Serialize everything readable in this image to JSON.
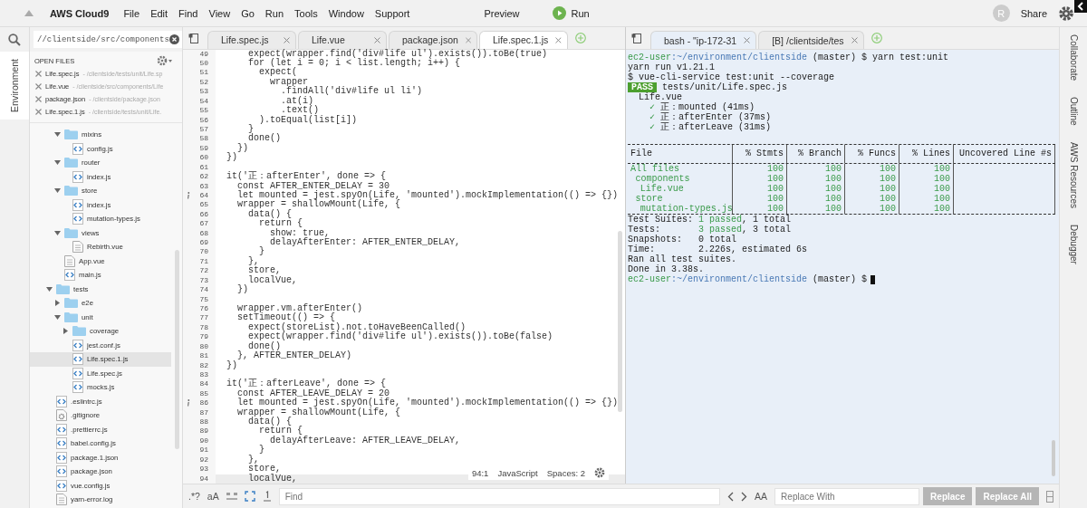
{
  "menu_bar": {
    "app_name": "AWS Cloud9",
    "menus": [
      "File",
      "Edit",
      "Find",
      "View",
      "Go",
      "Run",
      "Tools",
      "Window",
      "Support"
    ],
    "preview": "Preview",
    "run": "Run",
    "avatar": "R",
    "share": "Share"
  },
  "left_panel": {
    "tabs": [
      {
        "label": "Environment",
        "selected": true
      }
    ]
  },
  "sidebar": {
    "search": {
      "value": "//clientside/src/components"
    },
    "open_files_title": "OPEN FILES",
    "open_files": [
      {
        "name": "Life.spec.js",
        "path": "- /clientside/tests/unit/Life.sp"
      },
      {
        "name": "Life.vue",
        "path": "- /clientside/src/components/Life"
      },
      {
        "name": "package.json",
        "path": "- /clientside/package.json"
      },
      {
        "name": "Life.spec.1.js",
        "path": "- /clientside/tests/unit/Life."
      }
    ],
    "tree": [
      {
        "children": [
          {
            "name": "mixins",
            "kind": "folder",
            "expanded": true,
            "selected": false,
            "children": [
              {
                "name": "config.js",
                "kind": "code",
                "selected": false
              }
            ]
          },
          {
            "name": "router",
            "kind": "folder",
            "expanded": true,
            "selected": false,
            "children": [
              {
                "name": "index.js",
                "kind": "code",
                "selected": false
              }
            ]
          },
          {
            "name": "store",
            "kind": "folder",
            "expanded": true,
            "selected": false,
            "children": [
              {
                "name": "index.js",
                "kind": "code",
                "selected": false
              },
              {
                "name": "mutation-types.js",
                "kind": "code",
                "selected": false
              }
            ]
          },
          {
            "name": "views",
            "kind": "folder",
            "expanded": true,
            "selected": false,
            "children": [
              {
                "name": "Rebirth.vue",
                "kind": "doc",
                "selected": false
              }
            ]
          },
          {
            "name": "App.vue",
            "kind": "doc",
            "selected": false
          },
          {
            "name": "main.js",
            "kind": "code",
            "selected": false
          }
        ]
      },
      {
        "name": "tests",
        "kind": "folder",
        "expanded": true,
        "selected": false,
        "children": [
          {
            "name": "e2e",
            "kind": "folder",
            "expanded": false,
            "selected": false
          },
          {
            "name": "unit",
            "kind": "folder",
            "expanded": true,
            "selected": false,
            "children": [
              {
                "name": "coverage",
                "kind": "folder",
                "expanded": false,
                "selected": false
              },
              {
                "name": "jest.conf.js",
                "kind": "code",
                "selected": false
              },
              {
                "name": "Life.spec.1.js",
                "kind": "code",
                "selected": true
              },
              {
                "name": "Life.spec.js",
                "kind": "code",
                "selected": false
              },
              {
                "name": "mocks.js",
                "kind": "code",
                "selected": false
              }
            ]
          }
        ]
      },
      {
        "name": ".eslintrc.js",
        "kind": "code",
        "selected": false
      },
      {
        "name": ".gitignore",
        "kind": "config",
        "selected": false
      },
      {
        "name": ".prettierrc.js",
        "kind": "code",
        "selected": false
      },
      {
        "name": "babel.config.js",
        "kind": "code",
        "selected": false
      },
      {
        "name": "package.1.json",
        "kind": "code",
        "selected": false
      },
      {
        "name": "package.json",
        "kind": "code",
        "selected": false
      },
      {
        "name": "vue.config.js",
        "kind": "code",
        "selected": false
      },
      {
        "name": "yarn-error.log",
        "kind": "doc",
        "selected": false
      }
    ]
  },
  "editor": {
    "tabs": [
      {
        "label": "Life.spec.js",
        "selected": false
      },
      {
        "label": "Life.vue",
        "selected": false
      },
      {
        "label": "package.json",
        "selected": false
      },
      {
        "label": "Life.spec.1.js",
        "selected": true
      }
    ],
    "lines": [
      {
        "n": "49",
        "code": "      expect(wrapper.find('div#life ul').exists()).toBe(true)",
        "info": false,
        "current": false
      },
      {
        "n": "50",
        "code": "      for (let i = 0; i < list.length; i++) {",
        "info": false,
        "current": false
      },
      {
        "n": "51",
        "code": "        expect(",
        "info": false,
        "current": false
      },
      {
        "n": "52",
        "code": "          wrapper",
        "info": false,
        "current": false
      },
      {
        "n": "53",
        "code": "            .findAll('div#life ul li')",
        "info": false,
        "current": false
      },
      {
        "n": "54",
        "code": "            .at(i)",
        "info": false,
        "current": false
      },
      {
        "n": "55",
        "code": "            .text()",
        "info": false,
        "current": false
      },
      {
        "n": "56",
        "code": "        ).toEqual(list[i])",
        "info": false,
        "current": false
      },
      {
        "n": "57",
        "code": "      }",
        "info": false,
        "current": false
      },
      {
        "n": "58",
        "code": "      done()",
        "info": false,
        "current": false
      },
      {
        "n": "59",
        "code": "    })",
        "info": false,
        "current": false
      },
      {
        "n": "60",
        "code": "  })",
        "info": false,
        "current": false
      },
      {
        "n": "61",
        "info": false,
        "current": false
      },
      {
        "n": "62",
        "code": "  it('正：afterEnter', done => {",
        "info": false,
        "current": false
      },
      {
        "n": "63",
        "code": "    const AFTER_ENTER_DELAY = 30",
        "info": false,
        "current": false
      },
      {
        "n": "64",
        "code": "    let mounted = jest.spyOn(Life, 'mounted').mockImplementation(() => {})",
        "info": true,
        "current": false
      },
      {
        "n": "65",
        "code": "    wrapper = shallowMount(Life, {",
        "info": false,
        "current": false
      },
      {
        "n": "66",
        "code": "      data() {",
        "info": false,
        "current": false
      },
      {
        "n": "67",
        "code": "        return {",
        "info": false,
        "current": false
      },
      {
        "n": "68",
        "code": "          show: true,",
        "info": false,
        "current": false
      },
      {
        "n": "69",
        "code": "          delayAfterEnter: AFTER_ENTER_DELAY,",
        "info": false,
        "current": false
      },
      {
        "n": "70",
        "code": "        }",
        "info": false,
        "current": false
      },
      {
        "n": "71",
        "code": "      },",
        "info": false,
        "current": false
      },
      {
        "n": "72",
        "code": "      store,",
        "info": false,
        "current": false
      },
      {
        "n": "73",
        "code": "      localVue,",
        "info": false,
        "current": false
      },
      {
        "n": "74",
        "code": "    })",
        "info": false,
        "current": false
      },
      {
        "n": "75",
        "info": false,
        "current": false
      },
      {
        "n": "76",
        "code": "    wrapper.vm.afterEnter()",
        "info": false,
        "current": false
      },
      {
        "n": "77",
        "code": "    setTimeout(() => {",
        "info": false,
        "current": false
      },
      {
        "n": "78",
        "code": "      expect(storeList).not.toHaveBeenCalled()",
        "info": false,
        "current": false
      },
      {
        "n": "79",
        "code": "      expect(wrapper.find('div#life ul').exists()).toBe(false)",
        "info": false,
        "current": false
      },
      {
        "n": "80",
        "code": "      done()",
        "info": false,
        "current": false
      },
      {
        "n": "81",
        "code": "    }, AFTER_ENTER_DELAY)",
        "info": false,
        "current": false
      },
      {
        "n": "82",
        "code": "  })",
        "info": false,
        "current": false
      },
      {
        "n": "83",
        "info": false,
        "current": false
      },
      {
        "n": "84",
        "code": "  it('正：afterLeave', done => {",
        "info": false,
        "current": false
      },
      {
        "n": "85",
        "code": "    const AFTER_LEAVE_DELAY = 20",
        "info": false,
        "current": false
      },
      {
        "n": "86",
        "code": "    let mounted = jest.spyOn(Life, 'mounted').mockImplementation(() => {})",
        "info": true,
        "current": false
      },
      {
        "n": "87",
        "code": "    wrapper = shallowMount(Life, {",
        "info": false,
        "current": false
      },
      {
        "n": "88",
        "code": "      data() {",
        "info": false,
        "current": false
      },
      {
        "n": "89",
        "code": "        return {",
        "info": false,
        "current": false
      },
      {
        "n": "90",
        "code": "          delayAfterLeave: AFTER_LEAVE_DELAY,",
        "info": false,
        "current": false
      },
      {
        "n": "91",
        "code": "        }",
        "info": false,
        "current": false
      },
      {
        "n": "92",
        "code": "      },",
        "info": false,
        "current": false
      },
      {
        "n": "93",
        "code": "      store,",
        "info": false,
        "current": false
      },
      {
        "n": "94",
        "code": "      localVue,",
        "info": false,
        "current": true
      }
    ],
    "status": {
      "position": "94:1",
      "language": "JavaScript",
      "indent": "Spaces: 2"
    }
  },
  "terminal": {
    "tabs": [
      {
        "label": "bash - \"ip-172-31",
        "selected": true
      },
      {
        "label": "[B] /clientside/tes",
        "selected": false
      }
    ],
    "lines_before": [
      {
        "segments": [
          {
            "text": "ec2-user",
            "kind": "user"
          },
          {
            "text": ":~/environment/clientside",
            "kind": "path"
          },
          {
            "text": " (master) $ yarn test:unit",
            "kind": "plain"
          }
        ]
      },
      {
        "segments": [
          {
            "text": "yarn run v1.21.1",
            "kind": "plain"
          }
        ]
      },
      {
        "segments": [
          {
            "text": "$ vue-cli-service test:unit --coverage",
            "kind": "plain"
          }
        ]
      },
      {
        "segments": [
          {
            "text": "PASS",
            "kind": "badge"
          },
          {
            "text": " tests/unit/Life.spec.js",
            "kind": "plain"
          }
        ]
      },
      {
        "segments": [
          {
            "text": "  Life.vue",
            "kind": "plain"
          }
        ]
      },
      {
        "segments": [
          {
            "text": "    ✓",
            "kind": "ok"
          },
          {
            "text": " 正：mounted (41ms)",
            "kind": "plain"
          }
        ]
      },
      {
        "segments": [
          {
            "text": "    ✓",
            "kind": "ok"
          },
          {
            "text": " 正：afterEnter (37ms)",
            "kind": "plain"
          }
        ]
      },
      {
        "segments": [
          {
            "text": "    ✓",
            "kind": "ok"
          },
          {
            "text": " 正：afterLeave (31ms)",
            "kind": "plain"
          }
        ]
      }
    ],
    "coverage": {
      "columns": [
        "File",
        "% Stmts",
        "% Branch",
        "% Funcs",
        "% Lines",
        "Uncovered Line #s"
      ],
      "rows": [
        {
          "file": "All files",
          "values": [
            "100",
            "100",
            "100",
            "100"
          ],
          "children": [
            {
              "file": "components",
              "values": [
                "100",
                "100",
                "100",
                "100"
              ],
              "children": [
                {
                  "file": "Life.vue",
                  "values": [
                    "100",
                    "100",
                    "100",
                    "100"
                  ]
                }
              ]
            },
            {
              "file": "store",
              "values": [
                "100",
                "100",
                "100",
                "100"
              ],
              "children": [
                {
                  "file": "mutation-types.js",
                  "values": [
                    "100",
                    "100",
                    "100",
                    "100"
                  ]
                }
              ]
            }
          ]
        }
      ]
    },
    "lines_after": [
      {
        "segments": [
          {
            "text": "Test Suites: ",
            "kind": "plain"
          },
          {
            "text": "1 passed",
            "kind": "ok"
          },
          {
            "text": ", 1 total",
            "kind": "plain"
          }
        ]
      },
      {
        "segments": [
          {
            "text": "Tests:       ",
            "kind": "plain"
          },
          {
            "text": "3 passed",
            "kind": "ok"
          },
          {
            "text": ", 3 total",
            "kind": "plain"
          }
        ]
      },
      {
        "segments": [
          {
            "text": "Snapshots:   0 total",
            "kind": "plain"
          }
        ]
      },
      {
        "segments": [
          {
            "text": "Time:        2.226s, estimated 6s",
            "kind": "plain"
          }
        ]
      },
      {
        "segments": [
          {
            "text": "Ran all test suites.",
            "kind": "plain"
          }
        ]
      },
      {
        "segments": [
          {
            "text": "Done in 3.38s.",
            "kind": "plain"
          }
        ]
      }
    ],
    "prompt": {
      "segments": [
        {
          "text": "ec2-user",
          "kind": "user"
        },
        {
          "text": ":~/environment/clientside",
          "kind": "path"
        },
        {
          "text": " (master) $",
          "kind": "plain"
        }
      ]
    }
  },
  "find_bar": {
    "options": [
      ".*?",
      "aA"
    ],
    "find_placeholder": "Find",
    "preserve_case": "AA",
    "replace_placeholder": "Replace With",
    "buttons": [
      {
        "label": "Replace",
        "disabled": true
      },
      {
        "label": "Replace All",
        "disabled": true
      }
    ]
  },
  "right_panel": {
    "tabs": [
      {
        "label": "Collaborate",
        "selected": false
      },
      {
        "label": "Outline",
        "selected": false
      },
      {
        "label": "AWS Resources",
        "selected": false
      },
      {
        "label": "Debugger",
        "selected": false
      }
    ]
  }
}
